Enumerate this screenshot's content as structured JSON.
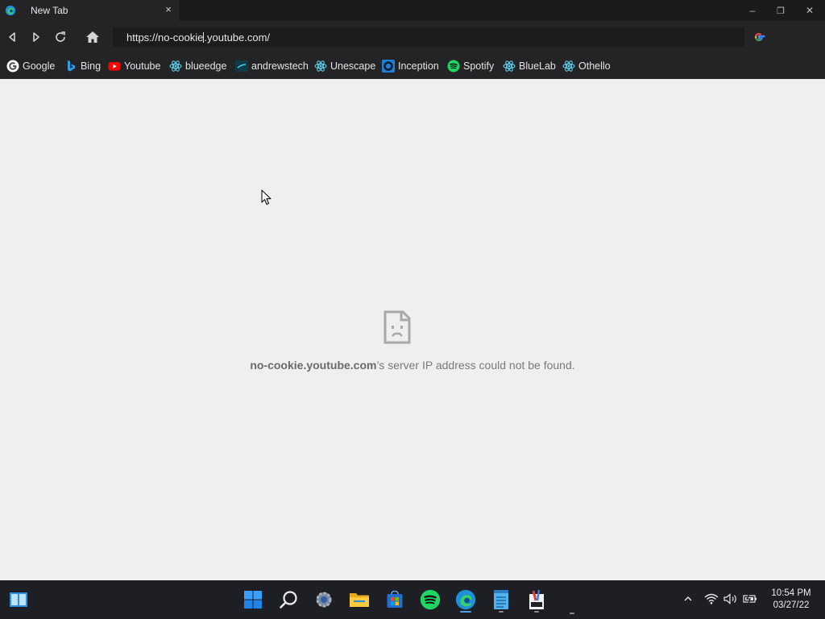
{
  "browser": {
    "tab_title": "New Tab",
    "tab_close": "×",
    "address": {
      "before_caret": "https://no-cookie",
      "after_caret": ".youtube.com/"
    },
    "window_controls": {
      "minimize": "–",
      "restore": "❐",
      "close": "✕"
    }
  },
  "bookmarks": [
    {
      "label": "Google",
      "icon": "google-icon"
    },
    {
      "label": "Bing",
      "icon": "bing-icon"
    },
    {
      "label": "Youtube",
      "icon": "youtube-icon"
    },
    {
      "label": "blueedge",
      "icon": "react-icon"
    },
    {
      "label": "andrewstech",
      "icon": "andrewstech-icon"
    },
    {
      "label": "Unescape",
      "icon": "react-icon"
    },
    {
      "label": "Inception",
      "icon": "inception-icon"
    },
    {
      "label": "Spotify",
      "icon": "spotify-icon"
    },
    {
      "label": "BlueLab",
      "icon": "react-icon"
    },
    {
      "label": "Othello",
      "icon": "react-icon"
    }
  ],
  "error": {
    "host": "no-cookie.youtube.com",
    "message": "’s server IP address could not be found."
  },
  "taskbar": {
    "clock_time": "10:54 PM",
    "clock_date": "03/27/22",
    "tray_chevron": "^"
  },
  "colors": {
    "accent": "#4aa3e8",
    "youtube_red": "#ff0000",
    "spotify_green": "#1ed760",
    "react_cyan": "#61dafb"
  }
}
